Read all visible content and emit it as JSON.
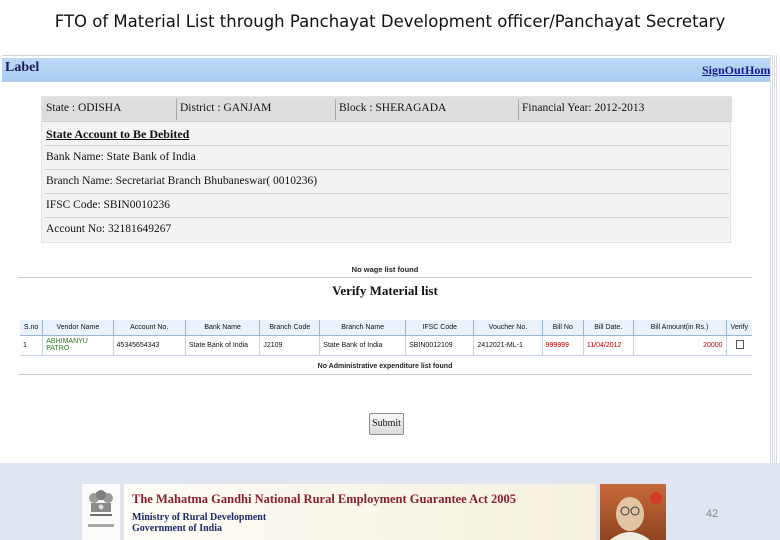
{
  "slide": {
    "title": "FTO of Material List through Panchayat Development officer/Panchayat Secretary",
    "page_number": "42"
  },
  "topbar": {
    "label": "Label",
    "signout": "SignOut",
    "home": "Home"
  },
  "info": {
    "state": "State : ODISHA",
    "district": "District : GANJAM",
    "block": "Block : SHERAGADA",
    "financial_year": "Financial Year: 2012-2013",
    "account_heading": "State Account to Be Debited",
    "bank_name": "Bank Name: State Bank of India",
    "branch_name": "Branch Name: Secretariat Branch Bhubaneswar( 0010236)",
    "ifsc_code": "IFSC Code: SBIN0010236",
    "account_no": "Account No: 32181649267"
  },
  "wage_message": "No wage list found",
  "verify_title": "Verify Material list",
  "table": {
    "headers": [
      "S.no",
      "Vendor Name",
      "Account No.",
      "Bank Name",
      "Branch Code",
      "Branch Name",
      "IFSC Code",
      "Voucher No.",
      "Bill No",
      "Bill Date.",
      "Bill Amount(in Rs.)",
      "Verify"
    ],
    "rows": [
      [
        "1",
        "ABHIMANYU PATRO",
        "45345654343",
        "State Bank of India",
        "J2109",
        "State Bank of India",
        "SBIN0012109",
        "2412021-ML-1",
        "999999",
        "11/04/2012",
        "20000",
        ""
      ]
    ]
  },
  "admin_message": "No Administrative expenditure list found",
  "submit_label": "Submit",
  "footer": {
    "banner_title": "The Mahatma Gandhi National Rural Employment Guarantee Act 2005",
    "ministry": "Ministry of Rural Development",
    "government": "Government of India"
  }
}
